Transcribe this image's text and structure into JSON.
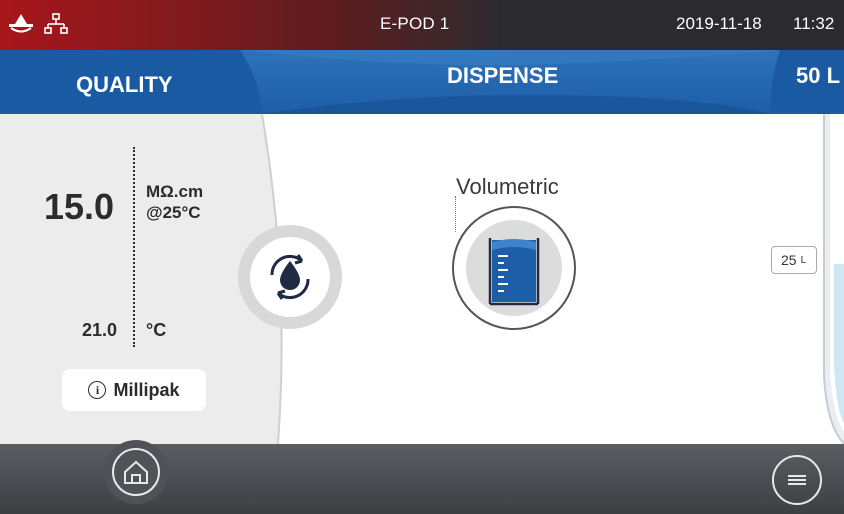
{
  "statusbar": {
    "title": "E-POD 1",
    "date": "2019-11-18",
    "time": "11:32"
  },
  "tabs": {
    "quality": "QUALITY",
    "dispense": "DISPENSE",
    "volume": "50 L"
  },
  "quality": {
    "resistivity_value": "15.0",
    "resistivity_unit": "MΩ.cm",
    "reference_temp": "@25°C",
    "temperature_value": "21.0",
    "temperature_unit": "°C",
    "filter_label": "Millipak"
  },
  "dispense": {
    "mode_label": "Volumetric"
  },
  "tank": {
    "level_value": "25",
    "level_unit": "L"
  },
  "colors": {
    "header_blue": "#1c5ea8",
    "brand_red": "#a8161b",
    "icon_blue": "#1c5ea8",
    "water_light": "#cfe6f5"
  }
}
